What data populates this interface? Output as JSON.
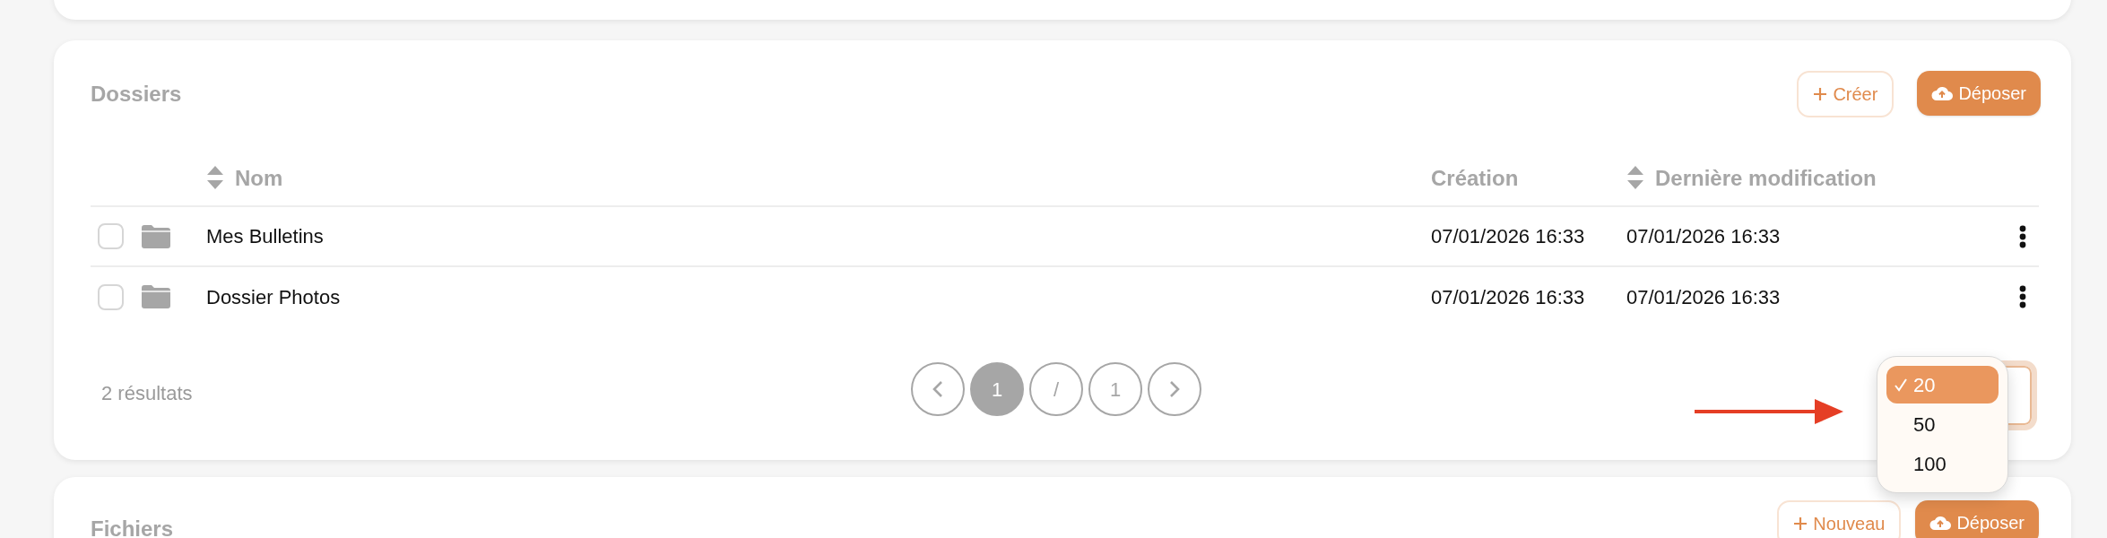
{
  "folders_card": {
    "title": "Dossiers",
    "buttons": [
      {
        "kind": "outline",
        "label": "Créer"
      },
      {
        "kind": "upload",
        "label": "Déposer"
      }
    ],
    "table": {
      "columns": [
        {
          "label": "Nom",
          "sortable": true
        },
        {
          "label": "Création",
          "sortable": false
        },
        {
          "label": "Dernière modification",
          "sortable": true
        }
      ],
      "rows": [
        {
          "name": "Mes Bulletins",
          "created": "07/01/2026 16:33",
          "modified": "07/01/2026 16:33",
          "checked": false
        },
        {
          "name": "Dossier Photos",
          "created": "07/01/2026 16:33",
          "modified": "07/01/2026 16:33",
          "checked": false
        }
      ]
    },
    "results": "2 résultats",
    "pagination": [
      {
        "kind": "prev"
      },
      {
        "kind": "page",
        "label": "1",
        "selected": true
      },
      {
        "kind": "page",
        "label": "/",
        "selected": false
      },
      {
        "kind": "page",
        "label": "1",
        "selected": false
      },
      {
        "kind": "next"
      }
    ],
    "page_size_menu": {
      "options": [
        {
          "label": "20",
          "selected": true
        },
        {
          "label": "50",
          "selected": false
        },
        {
          "label": "100",
          "selected": false
        }
      ]
    }
  },
  "files_card": {
    "title": "Fichiers",
    "buttons": [
      {
        "kind": "outline",
        "label": "Nouveau"
      },
      {
        "kind": "upload",
        "label": "Déposer"
      }
    ]
  }
}
